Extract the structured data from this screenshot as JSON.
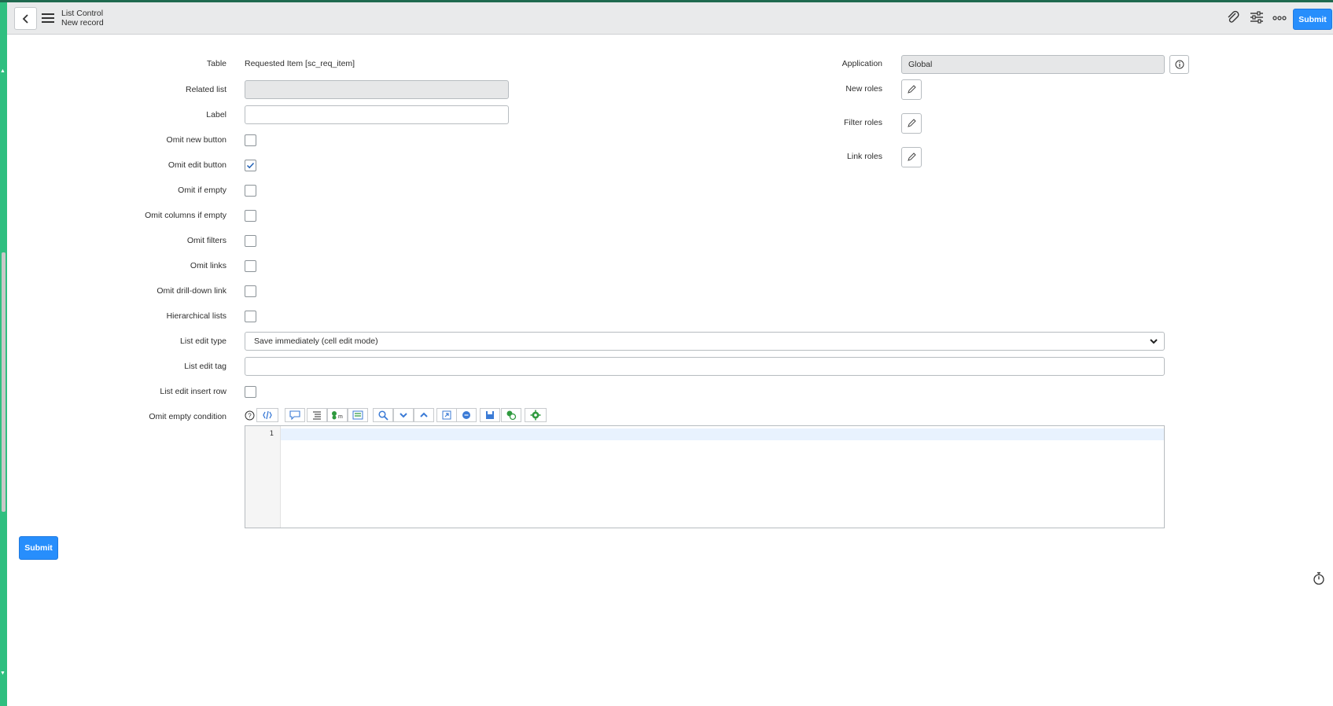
{
  "header": {
    "title": "List Control",
    "subtitle": "New record",
    "submit_label": "Submit"
  },
  "form": {
    "table_label": "Table",
    "table_value": "Requested Item [sc_req_item]",
    "related_list_label": "Related list",
    "label_label": "Label",
    "checkbox_fields": [
      {
        "label": "Omit new button",
        "checked": false
      },
      {
        "label": "Omit edit button",
        "checked": true
      },
      {
        "label": "Omit if empty",
        "checked": false
      },
      {
        "label": "Omit columns if empty",
        "checked": false
      },
      {
        "label": "Omit filters",
        "checked": false
      },
      {
        "label": "Omit links",
        "checked": false
      },
      {
        "label": "Omit drill-down link",
        "checked": false
      },
      {
        "label": "Hierarchical lists",
        "checked": false
      }
    ],
    "list_edit_type_label": "List edit type",
    "list_edit_type_value": "Save immediately (cell edit mode)",
    "list_edit_tag_label": "List edit tag",
    "list_edit_insert_row_label": "List edit insert row",
    "omit_empty_condition_label": "Omit empty condition",
    "editor_line_number": "1",
    "application_label": "Application",
    "application_value": "Global",
    "new_roles_label": "New roles",
    "filter_roles_label": "Filter roles",
    "link_roles_label": "Link roles",
    "bottom_submit_label": "Submit"
  },
  "icons": {
    "back": "chevron-left-icon",
    "menu": "hamburger-menu-icon",
    "attachment": "paperclip-icon",
    "settings": "sliders-icon",
    "more": "more-options-icon",
    "info": "info-icon",
    "edit": "pencil-icon",
    "timer": "stopwatch-icon"
  },
  "colors": {
    "accent": "#278efc",
    "header_bg": "#e9eaeb",
    "side_strip": "#2fbf80"
  }
}
